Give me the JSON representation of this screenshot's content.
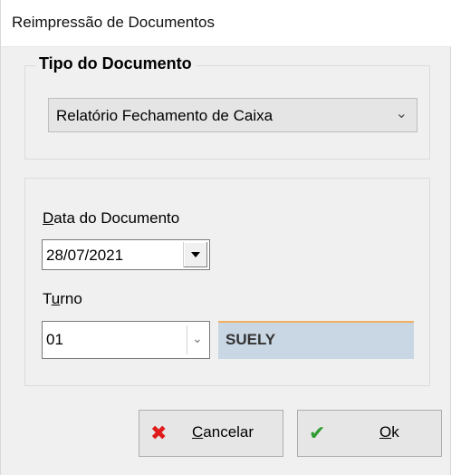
{
  "window": {
    "title": "Reimpressão de Documentos"
  },
  "tipo_documento": {
    "group_label": "Tipo do Documento",
    "selected": "Relatório Fechamento de Caixa"
  },
  "data_documento": {
    "label_prefix": "D",
    "label_rest": "ata do Documento",
    "value": "28/07/2021"
  },
  "turno": {
    "label_prefix": "T",
    "label_u": "u",
    "label_rest": "rno",
    "value": "01",
    "operator": "SUELY"
  },
  "buttons": {
    "cancel_u": "C",
    "cancel_rest": "ancelar",
    "ok_u": "O",
    "ok_rest": "k"
  },
  "colors": {
    "cancel_icon": "#e01b1b",
    "ok_icon": "#2e9b2e",
    "name_box_bg": "#c9d6e3",
    "name_box_top": "#f0b060"
  },
  "icons": {
    "cancel": "close-icon",
    "ok": "check-icon",
    "dropdown": "chevron-down-icon"
  }
}
